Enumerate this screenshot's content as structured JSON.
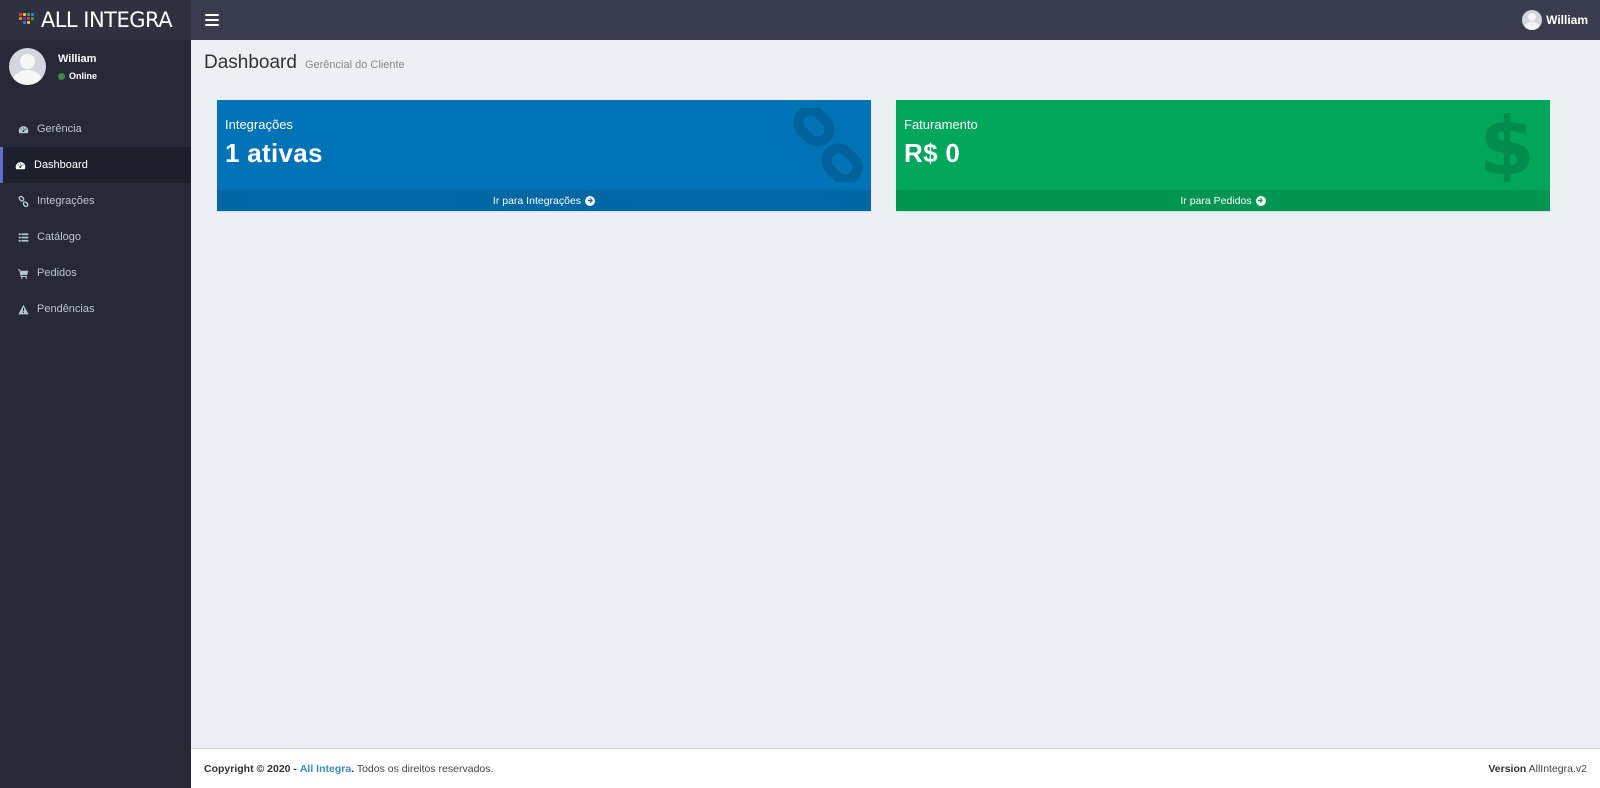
{
  "header": {
    "brand": "ALL INTEGRA",
    "user_name": "William"
  },
  "sidebar": {
    "user": {
      "name": "William",
      "status": "Online"
    },
    "items": [
      {
        "label": "Gerência",
        "icon": "dashboard-icon",
        "active": false
      },
      {
        "label": "Dashboard",
        "icon": "dashboard-icon",
        "active": true
      },
      {
        "label": "Integrações",
        "icon": "link-icon",
        "active": false
      },
      {
        "label": "Catálogo",
        "icon": "list-icon",
        "active": false
      },
      {
        "label": "Pedidos",
        "icon": "cart-icon",
        "active": false
      },
      {
        "label": "Pendências",
        "icon": "warning-icon",
        "active": false
      }
    ]
  },
  "main": {
    "title": "Dashboard",
    "subtitle": "Gerêncial do Cliente",
    "boxes": [
      {
        "label": "Integrações",
        "value": "1 ativas",
        "footer": "Ir para Integrações",
        "icon": "link-icon",
        "color": "#0073b7"
      },
      {
        "label": "Faturamento",
        "value": "R$ 0",
        "footer": "Ir para Pedidos",
        "icon": "dollar-icon",
        "color": "#00a65a"
      }
    ]
  },
  "footer": {
    "copyright_prefix": "Copyright © 2020 -",
    "company": "All Integra",
    "rights": "Todos os direitos reservados.",
    "version_label": "Version",
    "version_value": "AllIntegra.v2"
  },
  "colors": {
    "topbar": "#3a3d4d",
    "sidebar": "#272939",
    "active_accent": "#5f6ad3",
    "blue": "#0073b7",
    "green": "#00a65a",
    "online": "#3c8d3c"
  }
}
